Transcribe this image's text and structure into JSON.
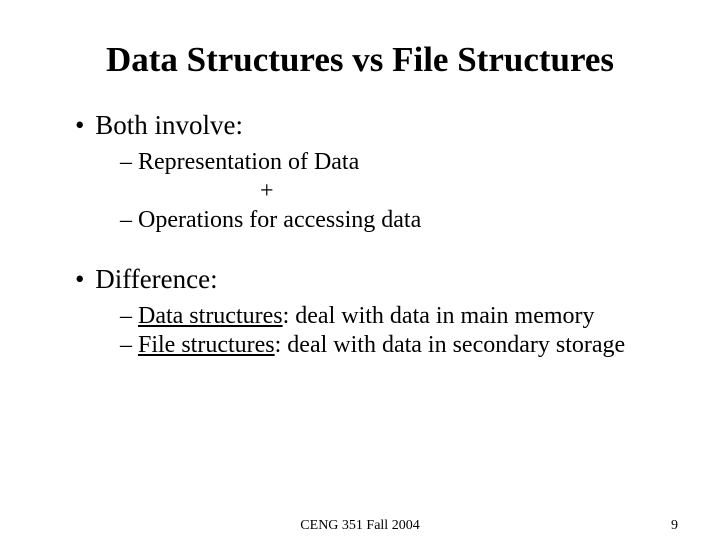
{
  "title": "Data Structures vs File Structures",
  "bullets": {
    "both_involve": "Both involve:",
    "representation": "Representation of Data",
    "plus": "+",
    "operations": "Operations for accessing data",
    "difference": "Difference:",
    "ds_label": "Data structures",
    "ds_rest": ": deal with data in main memory",
    "fs_label": "File structures",
    "fs_rest": ": deal with data in secondary storage"
  },
  "footer": {
    "center": "CENG 351 Fall 2004",
    "page": "9"
  }
}
